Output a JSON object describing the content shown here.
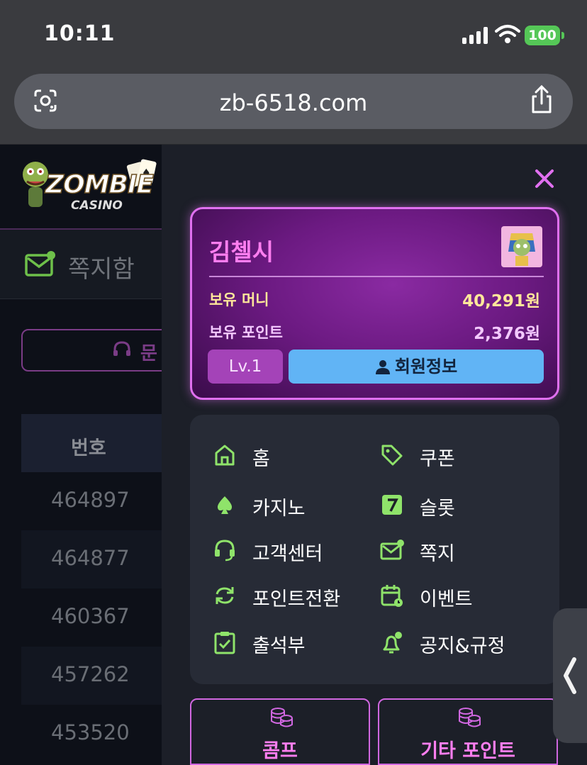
{
  "status": {
    "time": "10:11",
    "battery": "100"
  },
  "browser": {
    "url": "zb-6518.com"
  },
  "site": {
    "logo_main": "ZOMBIE",
    "logo_sub": "CASINO"
  },
  "background": {
    "msgbox_label": "쪽지함",
    "inquiry_label": "문",
    "table_header": "번호",
    "rows": [
      "464897",
      "464877",
      "460367",
      "457262",
      "453520"
    ]
  },
  "profile": {
    "name": "김첼시",
    "money_label": "보유 머니",
    "money_value": "40,291원",
    "point_label": "보유 포인트",
    "point_value": "2,376원",
    "level": "Lv.1",
    "member_button": "회원정보"
  },
  "menu": {
    "items": [
      {
        "label": "홈",
        "icon": "home-icon"
      },
      {
        "label": "쿠폰",
        "icon": "tag-icon"
      },
      {
        "label": "카지노",
        "icon": "spade-icon"
      },
      {
        "label": "슬롯",
        "icon": "seven-icon"
      },
      {
        "label": "고객센터",
        "icon": "headset-icon"
      },
      {
        "label": "쪽지",
        "icon": "mail-icon"
      },
      {
        "label": "포인트전환",
        "icon": "refresh-icon"
      },
      {
        "label": "이벤트",
        "icon": "calendar-icon"
      },
      {
        "label": "출석부",
        "icon": "clipboard-icon"
      },
      {
        "label": "공지&규정",
        "icon": "bell-icon"
      }
    ]
  },
  "bottom": {
    "comp_label": "콤프",
    "other_points_label": "기타 포인트"
  },
  "colors": {
    "accent": "#ff7ef0",
    "icon_green": "#8fe36a",
    "member_blue": "#61b4f5",
    "money_yellow": "#ffe79a"
  }
}
